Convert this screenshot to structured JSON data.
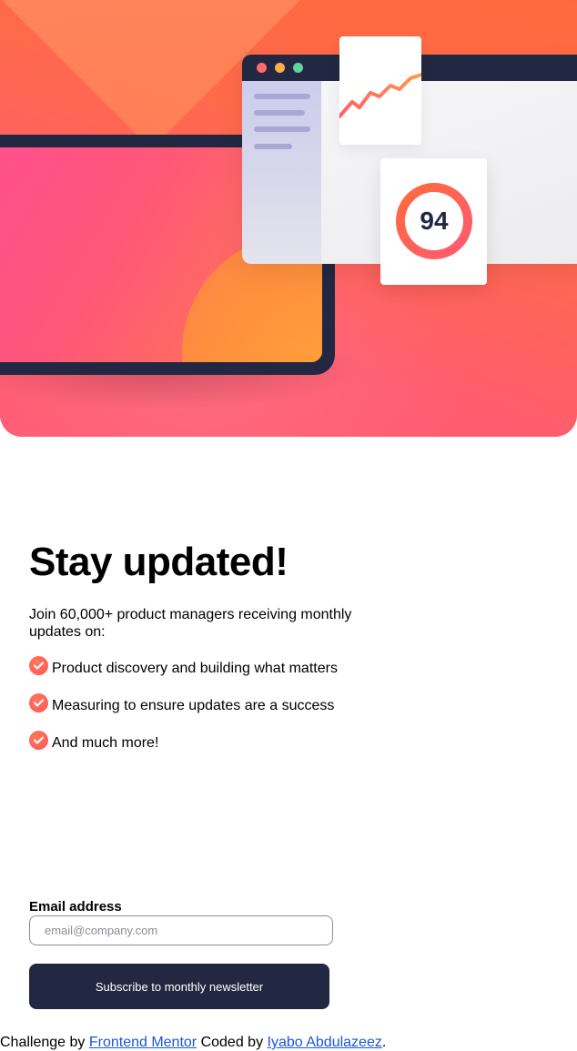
{
  "hero": {
    "score_value": "94",
    "colors": {
      "brand_dark": "#232842",
      "accent_tomato": "#ff6155",
      "dot_red": "#ff6b6b",
      "dot_yellow": "#ffae42",
      "dot_green": "#5fd3a0"
    },
    "icons": [
      "browser-window-icon",
      "trend-graph-icon",
      "score-ring-icon",
      "tablet-icon"
    ]
  },
  "content": {
    "title": "Stay updated!",
    "intro": "Join 60,000+ product managers receiving monthly updates on:",
    "list_icon": "check-circle-icon",
    "items": [
      "Product discovery and building what matters",
      "Measuring to ensure updates are a success",
      "And much more!"
    ]
  },
  "form": {
    "email_label": "Email address",
    "email_placeholder": "email@company.com",
    "email_value": "",
    "subscribe_label": "Subscribe to monthly newsletter"
  },
  "footer": {
    "challenge_prefix": "Challenge by ",
    "challenge_link": "Frontend Mentor",
    "coded_prefix": " Coded by ",
    "coded_link": "Iyabo Abdulazeez",
    "suffix": "."
  }
}
